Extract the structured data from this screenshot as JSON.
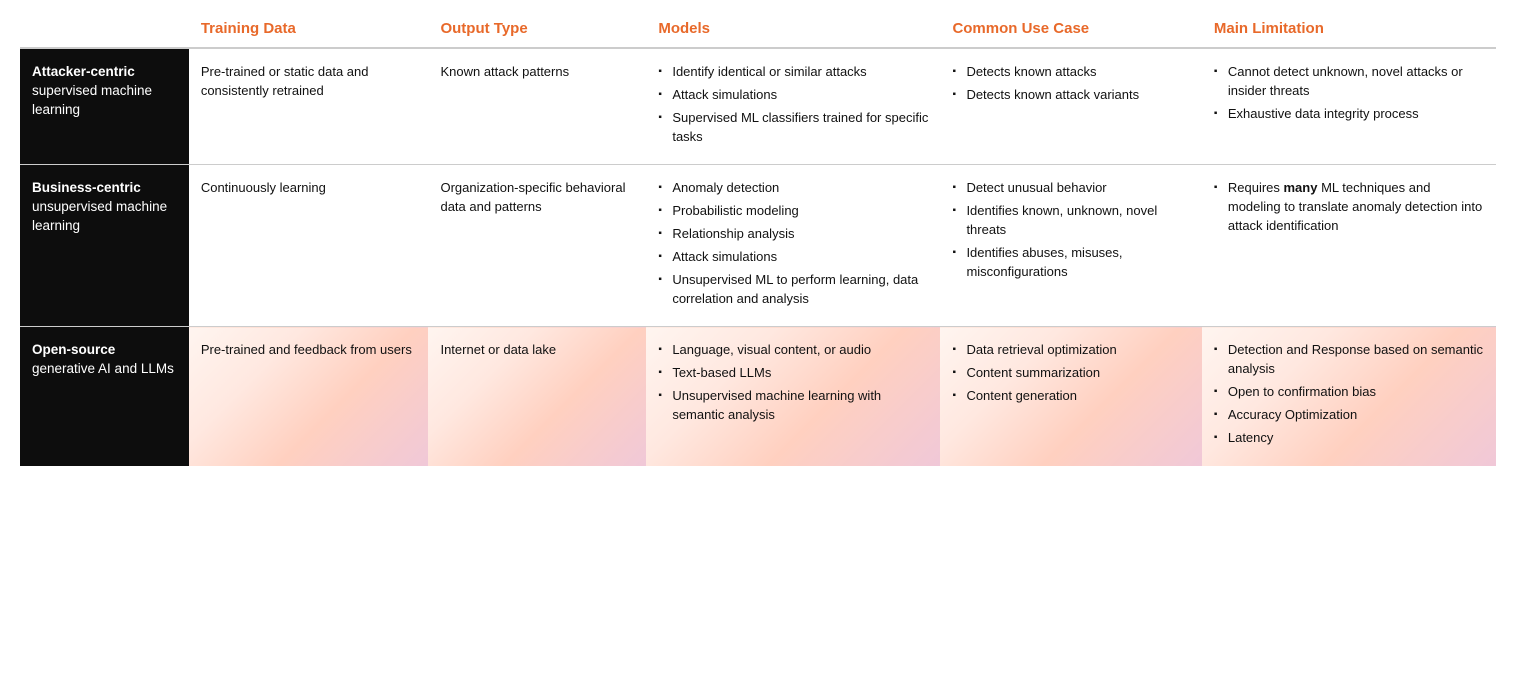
{
  "headers": {
    "col0": "",
    "col1": "Training Data",
    "col2": "Output Type",
    "col3": "Models",
    "col4": "Common Use Case",
    "col5": "Main Limitation"
  },
  "rows": [
    {
      "id": "attacker-centric",
      "header_bold": "Attacker-centric",
      "header_sub": "supervised machine learning",
      "training": "Pre-trained or static data and consistently retrained",
      "output": "Known attack patterns",
      "models": [
        "Identify identical or similar attacks",
        "Attack simulations",
        "Supervised ML classifiers trained for specific tasks"
      ],
      "use_case": [
        "Detects known attacks",
        "Detects known attack variants"
      ],
      "limitation": [
        "Cannot detect unknown, novel attacks or insider threats",
        "Exhaustive data integrity process"
      ],
      "limitation_rich": null
    },
    {
      "id": "business-centric",
      "header_bold": "Business-centric",
      "header_sub": "unsupervised machine learning",
      "training": "Continuously learning",
      "output": "Organization-specific behavioral data and patterns",
      "models": [
        "Anomaly detection",
        "Probabilistic modeling",
        "Relationship analysis",
        "Attack simulations",
        "Unsupervised ML to perform learning, data correlation and analysis"
      ],
      "use_case": [
        "Detect unusual behavior",
        "Identifies known, unknown, novel threats",
        "Identifies abuses, misuses, misconfigurations"
      ],
      "limitation": [
        "Requires many ML techniques and modeling to translate anomaly detection into attack identification"
      ],
      "limitation_rich": "Requires <strong>many</strong> ML techniques and modeling to translate anomaly detection into attack identification"
    },
    {
      "id": "open-source",
      "header_bold": "Open-source",
      "header_sub": "generative AI and LLMs",
      "training": "Pre-trained and feedback from users",
      "output": "Internet or data lake",
      "models": [
        "Language, visual content, or audio",
        "Text-based LLMs",
        "Unsupervised machine learning with semantic analysis"
      ],
      "use_case": [
        "Data retrieval optimization",
        "Content summarization",
        "Content generation"
      ],
      "limitation": [
        "Detection and Response based on semantic analysis",
        "Open to confirmation bias",
        "Accuracy Optimization",
        "Latency"
      ],
      "limitation_rich": null
    }
  ]
}
